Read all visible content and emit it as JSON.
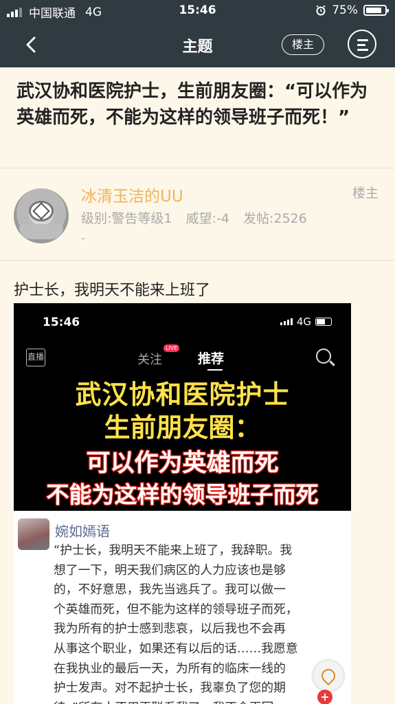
{
  "status_bar": {
    "carrier": "中国联通",
    "network": "4G",
    "time": "15:46",
    "battery": "75%"
  },
  "nav": {
    "title": "主题",
    "op_label": "楼主"
  },
  "article": {
    "title": "武汉协和医院护士，生前朋友圈：“可以作为英雄而死，不能为这样的领导班子而死！”"
  },
  "author": {
    "name": "冰清玉洁的UU",
    "tag": "楼主",
    "level": "级别:警告等级1",
    "prestige": "威望:-4",
    "posts": "发帖:2526",
    "extra": "-"
  },
  "post": {
    "text": "护士长，我明天不能来上班了"
  },
  "embedded": {
    "time": "15:46",
    "network": "4G",
    "live_label": "直播",
    "follow_label": "关注",
    "live_badge": "LIVE",
    "recommend_label": "推荐",
    "headline": [
      "武汉协和医院护士",
      "生前朋友圈：",
      "可以作为英雄而死",
      "不能为这样的领导班子而死"
    ],
    "user_name": "婉如嫣语",
    "paragraph": [
      "“护士长，我明天不能来上班了，我辞职。我",
      "想了一下，明天我们病区的人力应该也是够",
      "的，不好意思，我先当逃兵了。我可以做一",
      "个英雄而死，但不能为这样的领导班子而死，",
      "我为所有的护士感到悲哀，以后我也不会再",
      "从事这个职业，如果还有以后的话……我愿意",
      "在我执业的最后一天，为所有的临床一线的",
      "护士发声。对不起护士长，我辜负了您的期",
      "待。”所有人不用再联系我了，我不会再回"
    ],
    "plus_label": "+"
  },
  "colors": {
    "header_bg": "#2f3a41",
    "page_bg": "#fdf7e9",
    "author_name": "#f0b35c",
    "headline_yellow": "#ffe14a",
    "headline_red": "#e0261e"
  }
}
